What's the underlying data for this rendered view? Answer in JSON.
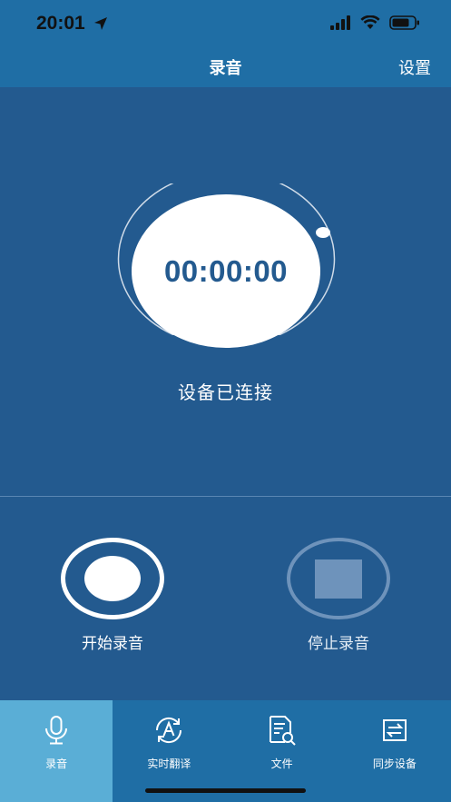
{
  "status_bar": {
    "time": "20:01",
    "icons": [
      "location-arrow-icon",
      "signal-icon",
      "wifi-icon",
      "battery-icon"
    ]
  },
  "nav": {
    "title": "录音",
    "settings_label": "设置"
  },
  "timer": {
    "value": "00:00:00",
    "device_status": "设备已连接"
  },
  "controls": {
    "start_label": "开始录音",
    "stop_label": "停止录音"
  },
  "tabs": [
    {
      "label": "录音",
      "icon": "microphone-icon",
      "active": true
    },
    {
      "label": "实时翻译",
      "icon": "translate-icon",
      "active": false
    },
    {
      "label": "文件",
      "icon": "file-search-icon",
      "active": false
    },
    {
      "label": "同步设备",
      "icon": "sync-icon",
      "active": false
    }
  ],
  "colors": {
    "background": "#235a8f",
    "bar": "#1f6ea5",
    "active_tab": "#5aaed6",
    "timer_text": "#235a8f"
  }
}
